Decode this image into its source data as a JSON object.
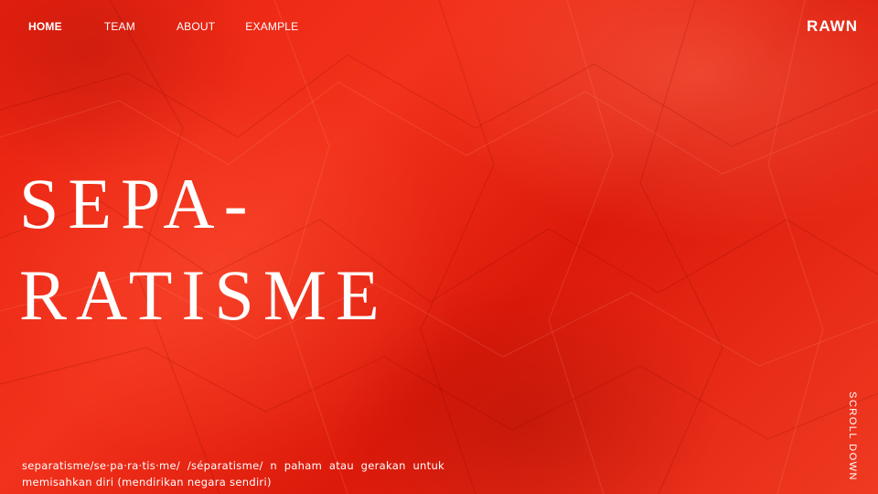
{
  "nav": {
    "items": [
      {
        "label": "HOME",
        "active": true
      },
      {
        "label": "TEAM"
      },
      {
        "label": "ABOUT"
      },
      {
        "label": "EXAMPLE"
      }
    ]
  },
  "brand": "RAWN",
  "hero": {
    "line1": "SEPA-",
    "line2": "RATISME"
  },
  "definition": "separatisme/se·pa·ra·tis·me/ /séparatisme/ n paham atau gerakan untuk memisahkan diri (mendirikan negara sendiri)",
  "scroll_label": "SCROLL DOWN",
  "colors": {
    "background": "#e8200f",
    "text": "#ffffff"
  }
}
